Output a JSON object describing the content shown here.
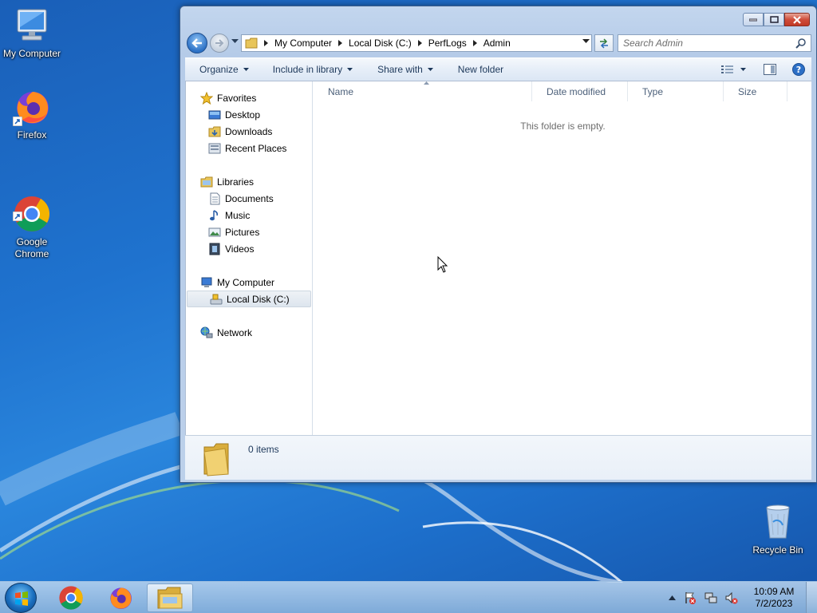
{
  "desktop": {
    "icons": [
      {
        "label": "My Computer"
      },
      {
        "label": "Firefox"
      },
      {
        "label": "Google\nChrome"
      },
      {
        "label": "Recycle Bin"
      }
    ]
  },
  "window": {
    "address": {
      "crumbs": [
        "My Computer",
        "Local Disk (C:)",
        "PerfLogs",
        "Admin"
      ]
    },
    "search": {
      "placeholder": "Search Admin"
    },
    "toolbar": {
      "organize": "Organize",
      "include_in_library": "Include in library",
      "share_with": "Share with",
      "new_folder": "New folder"
    },
    "navpane": {
      "favorites": "Favorites",
      "favorites_items": [
        "Desktop",
        "Downloads",
        "Recent Places"
      ],
      "libraries": "Libraries",
      "libraries_items": [
        "Documents",
        "Music",
        "Pictures",
        "Videos"
      ],
      "computer": "My Computer",
      "computer_items": [
        "Local Disk (C:)"
      ],
      "network": "Network"
    },
    "columns": [
      "Name",
      "Date modified",
      "Type",
      "Size"
    ],
    "empty_message": "This folder is empty.",
    "details": {
      "item_count": "0 items"
    }
  },
  "taskbar": {
    "clock_time": "10:09 AM",
    "clock_date": "7/2/2023"
  },
  "colors": {
    "accent": "#1e395b",
    "desktop_blue": "#1f73cf"
  }
}
